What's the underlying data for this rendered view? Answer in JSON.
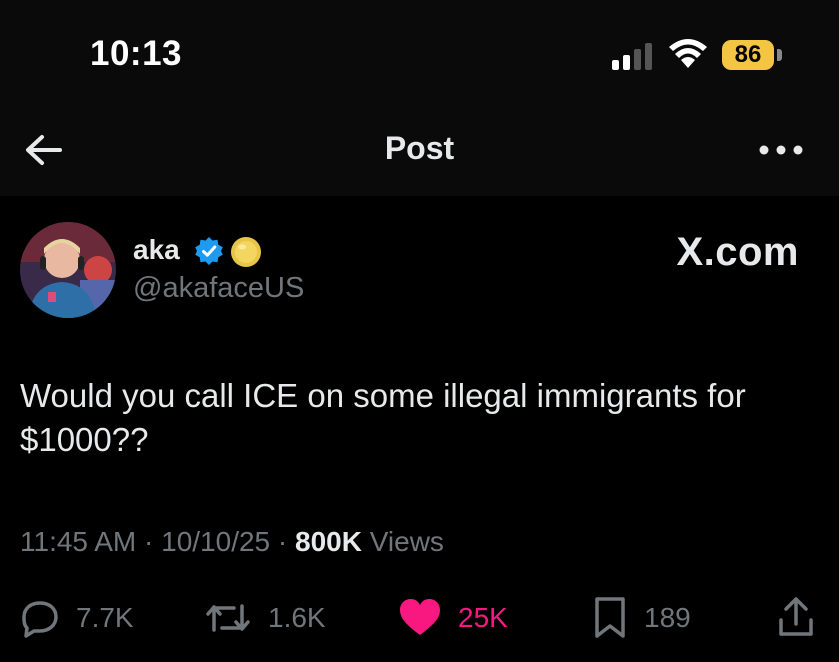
{
  "status_bar": {
    "time": "10:13",
    "battery": "86"
  },
  "nav": {
    "title": "Post"
  },
  "author": {
    "name": "aka",
    "handle": "@akafaceUS"
  },
  "brand": "X.com",
  "tweet": {
    "text": "Would you call ICE on some illegal immigrants for $1000??"
  },
  "meta": {
    "time": "11:45 AM",
    "date": "10/10/25",
    "views_count": "800K",
    "views_label": "Views",
    "separator": "·"
  },
  "actions": {
    "replies": "7.7K",
    "reposts": "1.6K",
    "likes": "25K",
    "bookmarks": "189"
  },
  "colors": {
    "like": "#f91880",
    "verified": "#1d9bf0",
    "battery": "#f4c542",
    "muted": "#71767b"
  }
}
